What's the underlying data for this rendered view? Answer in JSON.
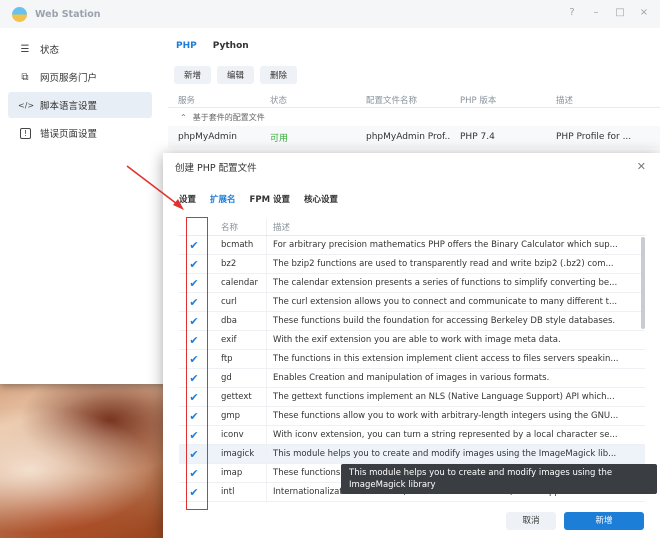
{
  "window": {
    "title": "Web Station",
    "controls": [
      "?",
      "–",
      "□",
      "×"
    ]
  },
  "sidebar": {
    "items": [
      {
        "label": "状态",
        "icon": "list-icon",
        "glyph": "☰"
      },
      {
        "label": "网页服务门户",
        "icon": "portal-icon",
        "glyph": "⧉"
      },
      {
        "label": "脚本语言设置",
        "icon": "code-icon",
        "glyph": "</>"
      },
      {
        "label": "错误页面设置",
        "icon": "error-page-icon",
        "glyph": "!"
      }
    ],
    "active_index": 2
  },
  "content": {
    "tabs": [
      "PHP",
      "Python"
    ],
    "toolbar": {
      "add": "新增",
      "edit": "编辑",
      "delete": "删除"
    },
    "columns": [
      "服务",
      "状态",
      "配置文件名称",
      "PHP 版本",
      "描述"
    ],
    "group_label": "基于套件的配置文件",
    "row": {
      "service": "phpMyAdmin",
      "status": "可用",
      "profile": "phpMyAdmin Prof...",
      "version": "PHP 7.4",
      "description": "PHP Profile for ..."
    }
  },
  "dialog": {
    "title": "创建 PHP 配置文件",
    "tabs": [
      "设置",
      "扩展名",
      "FPM 设置",
      "核心设置"
    ],
    "active_tab": 1,
    "columns": {
      "name": "名称",
      "description": "描述"
    },
    "extensions": [
      {
        "name": "bcmath",
        "description": "For arbitrary precision mathematics PHP offers the Binary Calculator which sup...",
        "checked": true
      },
      {
        "name": "bz2",
        "description": "The bzip2 functions are used to transparently read and write bzip2 (.bz2) com...",
        "checked": true
      },
      {
        "name": "calendar",
        "description": "The calendar extension presents a series of functions to simplify converting be...",
        "checked": true
      },
      {
        "name": "curl",
        "description": "The curl extension allows you to connect and communicate to many different t...",
        "checked": true
      },
      {
        "name": "dba",
        "description": "These functions build the foundation for accessing Berkeley DB style databases.",
        "checked": true
      },
      {
        "name": "exif",
        "description": "With the exif extension you are able to work with image meta data.",
        "checked": true
      },
      {
        "name": "ftp",
        "description": "The functions in this extension implement client access to files servers speakin...",
        "checked": true
      },
      {
        "name": "gd",
        "description": "Enables Creation and manipulation of images in various formats.",
        "checked": true
      },
      {
        "name": "gettext",
        "description": "The gettext functions implement an NLS (Native Language Support) API which...",
        "checked": true
      },
      {
        "name": "gmp",
        "description": "These functions allow you to work with arbitrary-length integers using the GNU...",
        "checked": true
      },
      {
        "name": "iconv",
        "description": "With iconv extension, you can turn a string represented by a local character se...",
        "checked": true
      },
      {
        "name": "imagick",
        "description": "This module helps you to create and modify images using the ImageMagick lib...",
        "checked": true
      },
      {
        "name": "imap",
        "description": "These functions enable you to operate with the IMAP protocol, as well as the N...",
        "checked": true
      },
      {
        "name": "intl",
        "description": "Internationalization extension (further is referred as Intl) is a wrapper for ICU l...",
        "checked": true
      }
    ],
    "hover_row_index": 11,
    "tooltip": "This module helps you to create and modify images using the ImageMagick library",
    "footer": {
      "cancel": "取消",
      "confirm": "新增"
    }
  },
  "colors": {
    "accent": "#1d7ed8",
    "annotation": "#e0322c",
    "available": "#3cae3c"
  }
}
